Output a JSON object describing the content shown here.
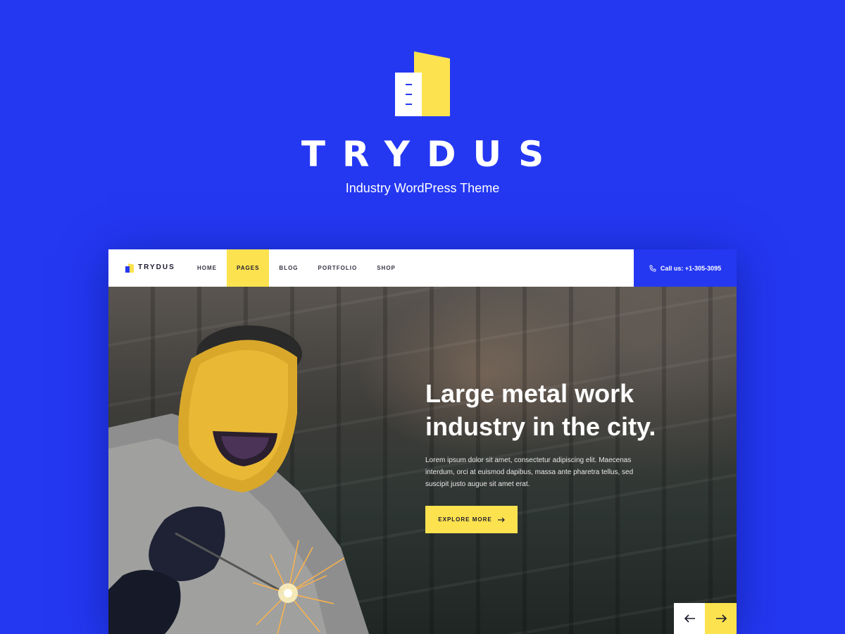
{
  "brand": {
    "name": "TRYDUS",
    "tagline": "Industry WordPress Theme"
  },
  "nav": {
    "brand": "TRYDUS",
    "items": [
      {
        "label": "HOME",
        "active": false
      },
      {
        "label": "PAGES",
        "active": true
      },
      {
        "label": "BLOG",
        "active": false
      },
      {
        "label": "PORTFOLIO",
        "active": false
      },
      {
        "label": "SHOP",
        "active": false
      }
    ],
    "call": "Call us: +1-305-3095"
  },
  "hero": {
    "title_line1": "Large metal work",
    "title_line2": "industry in the city.",
    "text": "Lorem ipsum dolor sit amet, consectetur adipiscing elit. Maecenas interdum, orci at euismod dapibus, massa ante pharetra tellus, sed suscipit justo augue sit amet erat.",
    "button": "EXPLORE MORE"
  },
  "slider": {
    "prev_icon": "arrow-left-icon",
    "next_icon": "arrow-right-icon"
  },
  "colors": {
    "accent_blue": "#2438f2",
    "accent_yellow": "#fde24f"
  }
}
